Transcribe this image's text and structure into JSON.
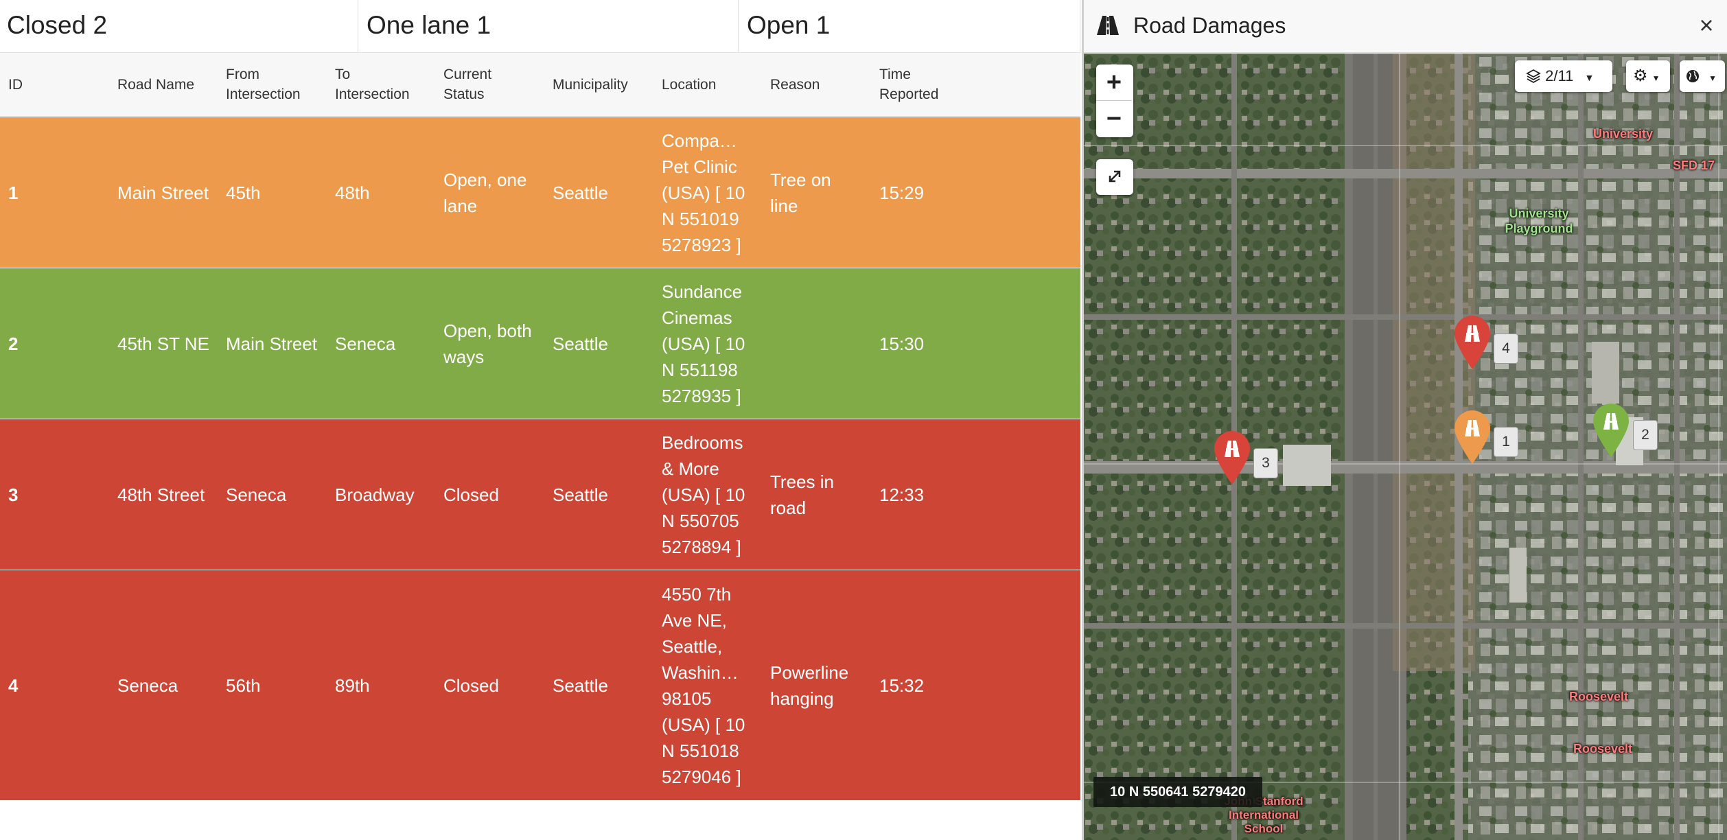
{
  "summary": [
    {
      "label": "Closed 2"
    },
    {
      "label": "One lane 1"
    },
    {
      "label": "Open 1"
    }
  ],
  "table": {
    "columns": [
      "ID",
      "Road Name",
      "From Intersection",
      "To Intersection",
      "Current Status",
      "Municipality",
      "Location",
      "Reason",
      "Time Reported"
    ],
    "rows": [
      {
        "id": "1",
        "road": "Main Street",
        "from": "45th",
        "to": "48th",
        "status": "Open, one lane",
        "municipality": "Seattle",
        "location": "Compa… Pet Clinic (USA) [ 10 N 551019 5278923 ]",
        "reason": "Tree on line",
        "time": "15:29",
        "color": "orange"
      },
      {
        "id": "2",
        "road": "45th ST NE",
        "from": "Main Street",
        "to": "Seneca",
        "status": "Open, both ways",
        "municipality": "Seattle",
        "location": "Sundance Cinemas (USA) [ 10 N 551198 5278935 ]",
        "reason": "",
        "time": "15:30",
        "color": "green"
      },
      {
        "id": "3",
        "road": "48th Street",
        "from": "Seneca",
        "to": "Broadway",
        "status": "Closed",
        "municipality": "Seattle",
        "location": "Bedrooms & More (USA) [ 10 N 550705 5278894 ]",
        "reason": "Trees in road",
        "time": "12:33",
        "color": "red"
      },
      {
        "id": "4",
        "road": "Seneca",
        "from": "56th",
        "to": "89th",
        "status": "Closed",
        "municipality": "Seattle",
        "location": "4550 7th Ave NE, Seattle, Washin… 98105 (USA) [ 10 N 551018 5279046 ]",
        "reason": "Powerline hanging",
        "time": "15:32",
        "color": "red"
      }
    ]
  },
  "panel": {
    "title": "Road Damages",
    "close_label": "×",
    "road_icon": "road-icon"
  },
  "map": {
    "layers_label": "2/11",
    "zoom_in": "+",
    "zoom_out": "−",
    "collapse_icon": "compress-icon",
    "settings_icon": "gear-icon",
    "globe_icon": "globe-icon",
    "coordinates": "10 N 550641 5279420",
    "labels": {
      "university": "University",
      "sfd": "SFD 17",
      "playground": "University Playground",
      "roosevelt": "Roosevelt",
      "stanford": "John Stanford International School"
    },
    "markers": [
      {
        "label": "4",
        "color": "#d8443a"
      },
      {
        "label": "1",
        "color": "#ed9a4d"
      },
      {
        "label": "2",
        "color": "#7cb342"
      },
      {
        "label": "3",
        "color": "#d8443a"
      }
    ]
  },
  "colors": {
    "orange": "#ed9a4d",
    "green": "#80ab46",
    "red": "#cc4535"
  }
}
